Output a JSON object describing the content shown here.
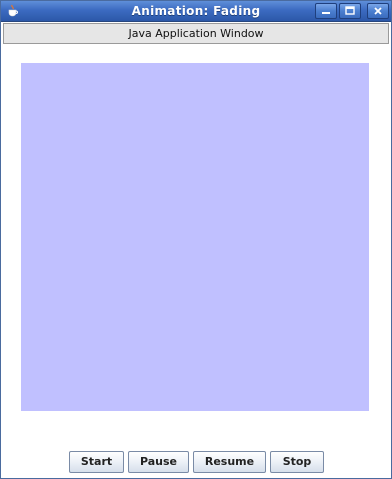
{
  "window": {
    "title": "Animation: Fading",
    "icon": "java-cup-icon"
  },
  "window_controls": {
    "minimize_icon": "minimize-icon",
    "maximize_icon": "maximize-icon",
    "close_icon": "close-icon"
  },
  "header": {
    "label": "Java Application Window"
  },
  "animation": {
    "square_color": "#c0c0ff"
  },
  "buttons": {
    "start": "Start",
    "pause": "Pause",
    "resume": "Resume",
    "stop": "Stop"
  },
  "colors": {
    "titlebar": "#3c6bc1",
    "header_bg": "#e6e6e6",
    "square": "#c0c0ff"
  }
}
